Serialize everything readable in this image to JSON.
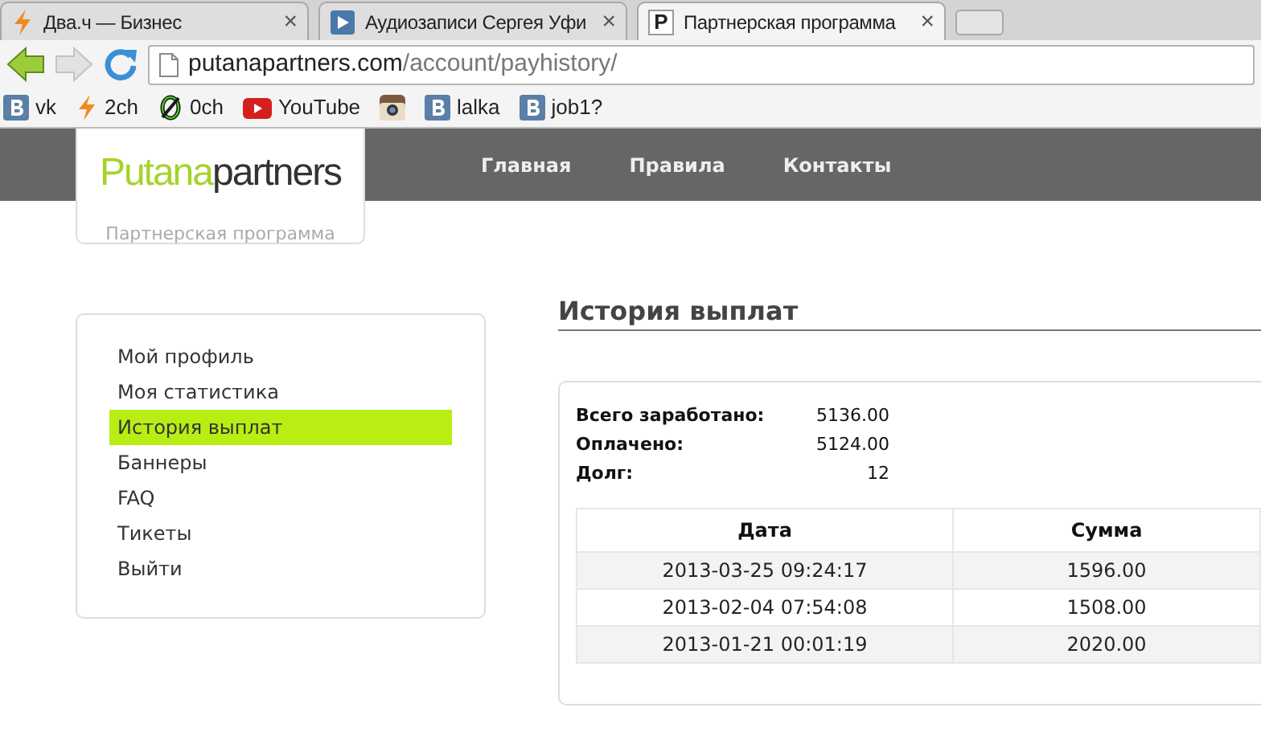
{
  "browser": {
    "tabs": [
      {
        "title": "Два.ч — Бизнес",
        "kind": "bolt",
        "selected": false,
        "close": "×"
      },
      {
        "title": "Аудиозаписи Сергея Уфи",
        "kind": "play",
        "selected": false,
        "close": "×"
      },
      {
        "title": "Партнерская программа",
        "kind": "letter",
        "icon_text": "P",
        "selected": true,
        "close": "×"
      }
    ],
    "url": {
      "host": "putanapartners.com",
      "path": "/account/payhistory/"
    },
    "bookmarks": [
      {
        "kind": "vk",
        "label": "vk"
      },
      {
        "kind": "bolt",
        "label": "2ch"
      },
      {
        "kind": "zero",
        "label": "0ch"
      },
      {
        "kind": "youtube",
        "label": "YouTube"
      },
      {
        "kind": "camera"
      },
      {
        "kind": "vk",
        "label": "lalka"
      },
      {
        "kind": "vk",
        "label": "job1?"
      }
    ]
  },
  "site": {
    "logo": {
      "first": "Putana",
      "second": "partners",
      "tagline": "Партнерская программа"
    },
    "nav": [
      "Главная",
      "Правила",
      "Контакты"
    ],
    "sidebar": [
      {
        "label": "Мой профиль",
        "selected": false
      },
      {
        "label": "Моя статистика",
        "selected": false
      },
      {
        "label": "История выплат",
        "selected": true
      },
      {
        "label": "Баннеры",
        "selected": false
      },
      {
        "label": "FAQ",
        "selected": false
      },
      {
        "label": "Тикеты",
        "selected": false
      },
      {
        "label": "Выйти",
        "selected": false
      }
    ],
    "title": "История выплат",
    "summary": [
      {
        "label": "Всего заработано:",
        "value": "5136.00"
      },
      {
        "label": "Оплачено:",
        "value": "5124.00"
      },
      {
        "label": "Долг:",
        "value": "12"
      }
    ],
    "table": {
      "columns": [
        "Дата",
        "Сумма"
      ],
      "rows": [
        [
          "2013-03-25 09:24:17",
          "1596.00"
        ],
        [
          "2013-02-04 07:54:08",
          "1508.00"
        ],
        [
          "2013-01-21 00:01:19",
          "2020.00"
        ]
      ]
    }
  }
}
